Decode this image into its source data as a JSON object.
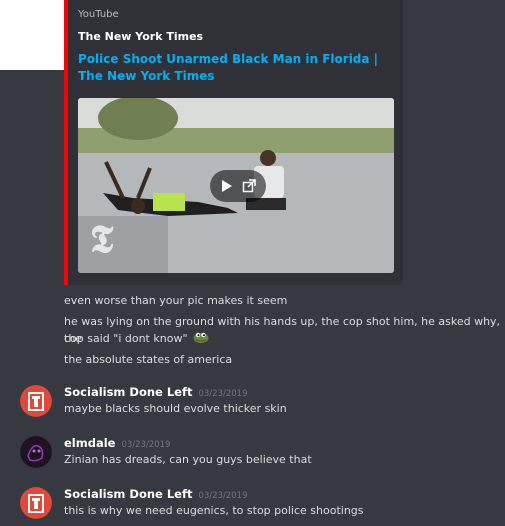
{
  "embed": {
    "provider": "YouTube",
    "author": "The New York Times",
    "title": "Police Shoot Unarmed Black Man in Florida | The New York Times",
    "accent_color": "#ff0000",
    "play_icon": "play-icon",
    "external_icon": "external-link-icon"
  },
  "messages_top": [
    {
      "text": "even worse than your pic makes it seem"
    },
    {
      "text": "he was lying on the ground with his hands up, the cop shot him, he asked why, the"
    },
    {
      "text": "cop said  \"i dont know\""
    },
    {
      "text": "the absolute states of america"
    }
  ],
  "groups": [
    {
      "username": "Socialism Done Left",
      "timestamp": "03/23/2019",
      "content": "maybe blacks should evolve thicker skin",
      "avatar": "red-avatar"
    },
    {
      "username": "elmdale",
      "timestamp": "03/23/2019",
      "content": "Zinian has dreads, can you guys believe that",
      "avatar": "dark-avatar"
    },
    {
      "username": "Socialism Done Left",
      "timestamp": "03/23/2019",
      "content": "this is why we need eugenics, to stop police shootings",
      "avatar": "red-avatar"
    }
  ],
  "colors": {
    "background": "#36393f",
    "embed_bg": "#2f3136",
    "link": "#00b0f4",
    "timestamp": "#72767d"
  }
}
